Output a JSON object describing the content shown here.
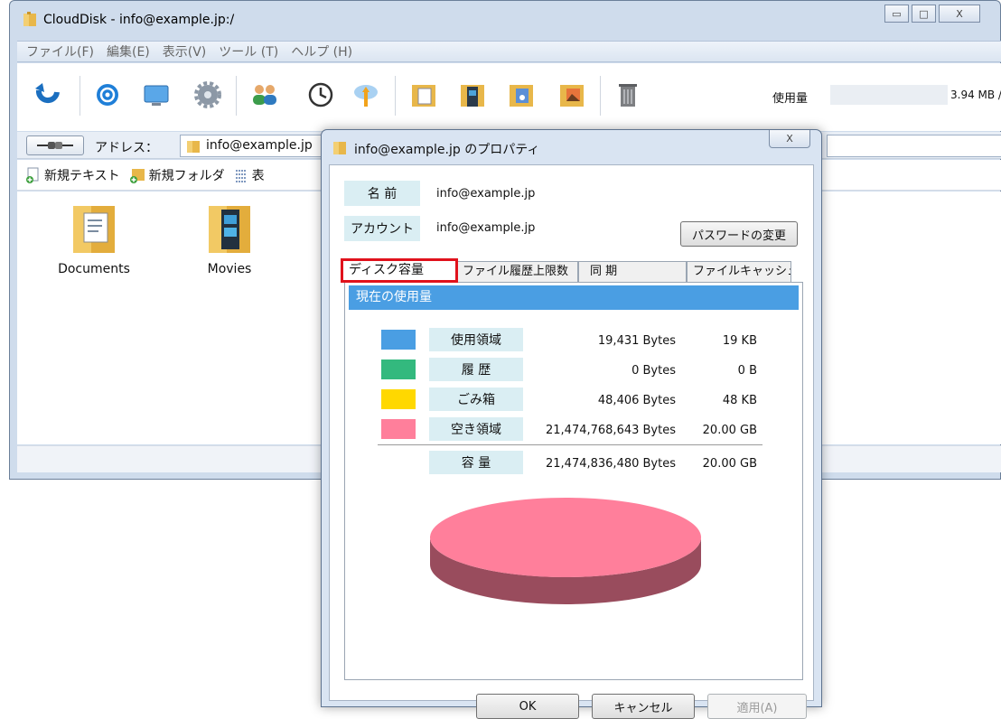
{
  "main_window": {
    "title": "CloudDisk - info@example.jp:/",
    "controls": {
      "minimize": "▭",
      "maximize": "□",
      "close": "X"
    },
    "menu": [
      "ファイル(F)",
      "編集(E)",
      "表示(V)",
      "ツール (T)",
      "ヘルプ (H)"
    ],
    "toolbar_icons": [
      "refresh-icon",
      "compass-icon",
      "monitor-icon",
      "gear-icon",
      "users-icon",
      "clock-icon",
      "cloud-sync-icon",
      "documents-folder-icon",
      "movies-folder-icon",
      "music-folder-icon",
      "pictures-folder-icon",
      "trash-icon"
    ],
    "usage": {
      "label": "使用量",
      "value": "3.94 MB /",
      "fill_fraction": 0.0002
    },
    "address": {
      "label": "アドレス：",
      "value": "info@example.jp"
    },
    "commands": [
      "新規テキスト",
      "新規フォルダ",
      "表"
    ],
    "files": [
      {
        "name": "Documents",
        "icon": "documents-folder-icon"
      },
      {
        "name": "Movies",
        "icon": "movies-folder-icon"
      }
    ]
  },
  "dialog": {
    "title": "info@example.jp のプロパティ",
    "close": "X",
    "name_label": "名 前",
    "name_value": "info@example.jp",
    "account_label": "アカウント",
    "account_value": "info@example.jp",
    "password_button": "パスワードの変更",
    "tabs": [
      "ディスク容量",
      "ファイル履歴上限数",
      "同 期",
      "ファイルキャッシュ"
    ],
    "section_title": "現在の使用量",
    "rows": [
      {
        "label": "使用領域",
        "bytes": "19,431 Bytes",
        "human": "19 KB",
        "color": "#4a9ee3"
      },
      {
        "label": "履 歴",
        "bytes": "0 Bytes",
        "human": "0 B",
        "color": "#33b97e"
      },
      {
        "label": "ごみ箱",
        "bytes": "48,406 Bytes",
        "human": "48 KB",
        "color": "#ffd800"
      },
      {
        "label": "空き領域",
        "bytes": "21,474,768,643 Bytes",
        "human": "20.00 GB",
        "color": "#ff7f9b"
      }
    ],
    "total": {
      "label": "容 量",
      "bytes": "21,474,836,480 Bytes",
      "human": "20.00 GB"
    },
    "buttons": {
      "ok": "OK",
      "cancel": "キャンセル",
      "apply": "適用(A)"
    }
  },
  "chart_data": {
    "type": "pie",
    "categories": [
      "使用領域",
      "履 歴",
      "ごみ箱",
      "空き領域"
    ],
    "values": [
      19431,
      0,
      48406,
      21474768643
    ],
    "colors": [
      "#4a9ee3",
      "#33b97e",
      "#ffd800",
      "#ff7f9b"
    ]
  }
}
